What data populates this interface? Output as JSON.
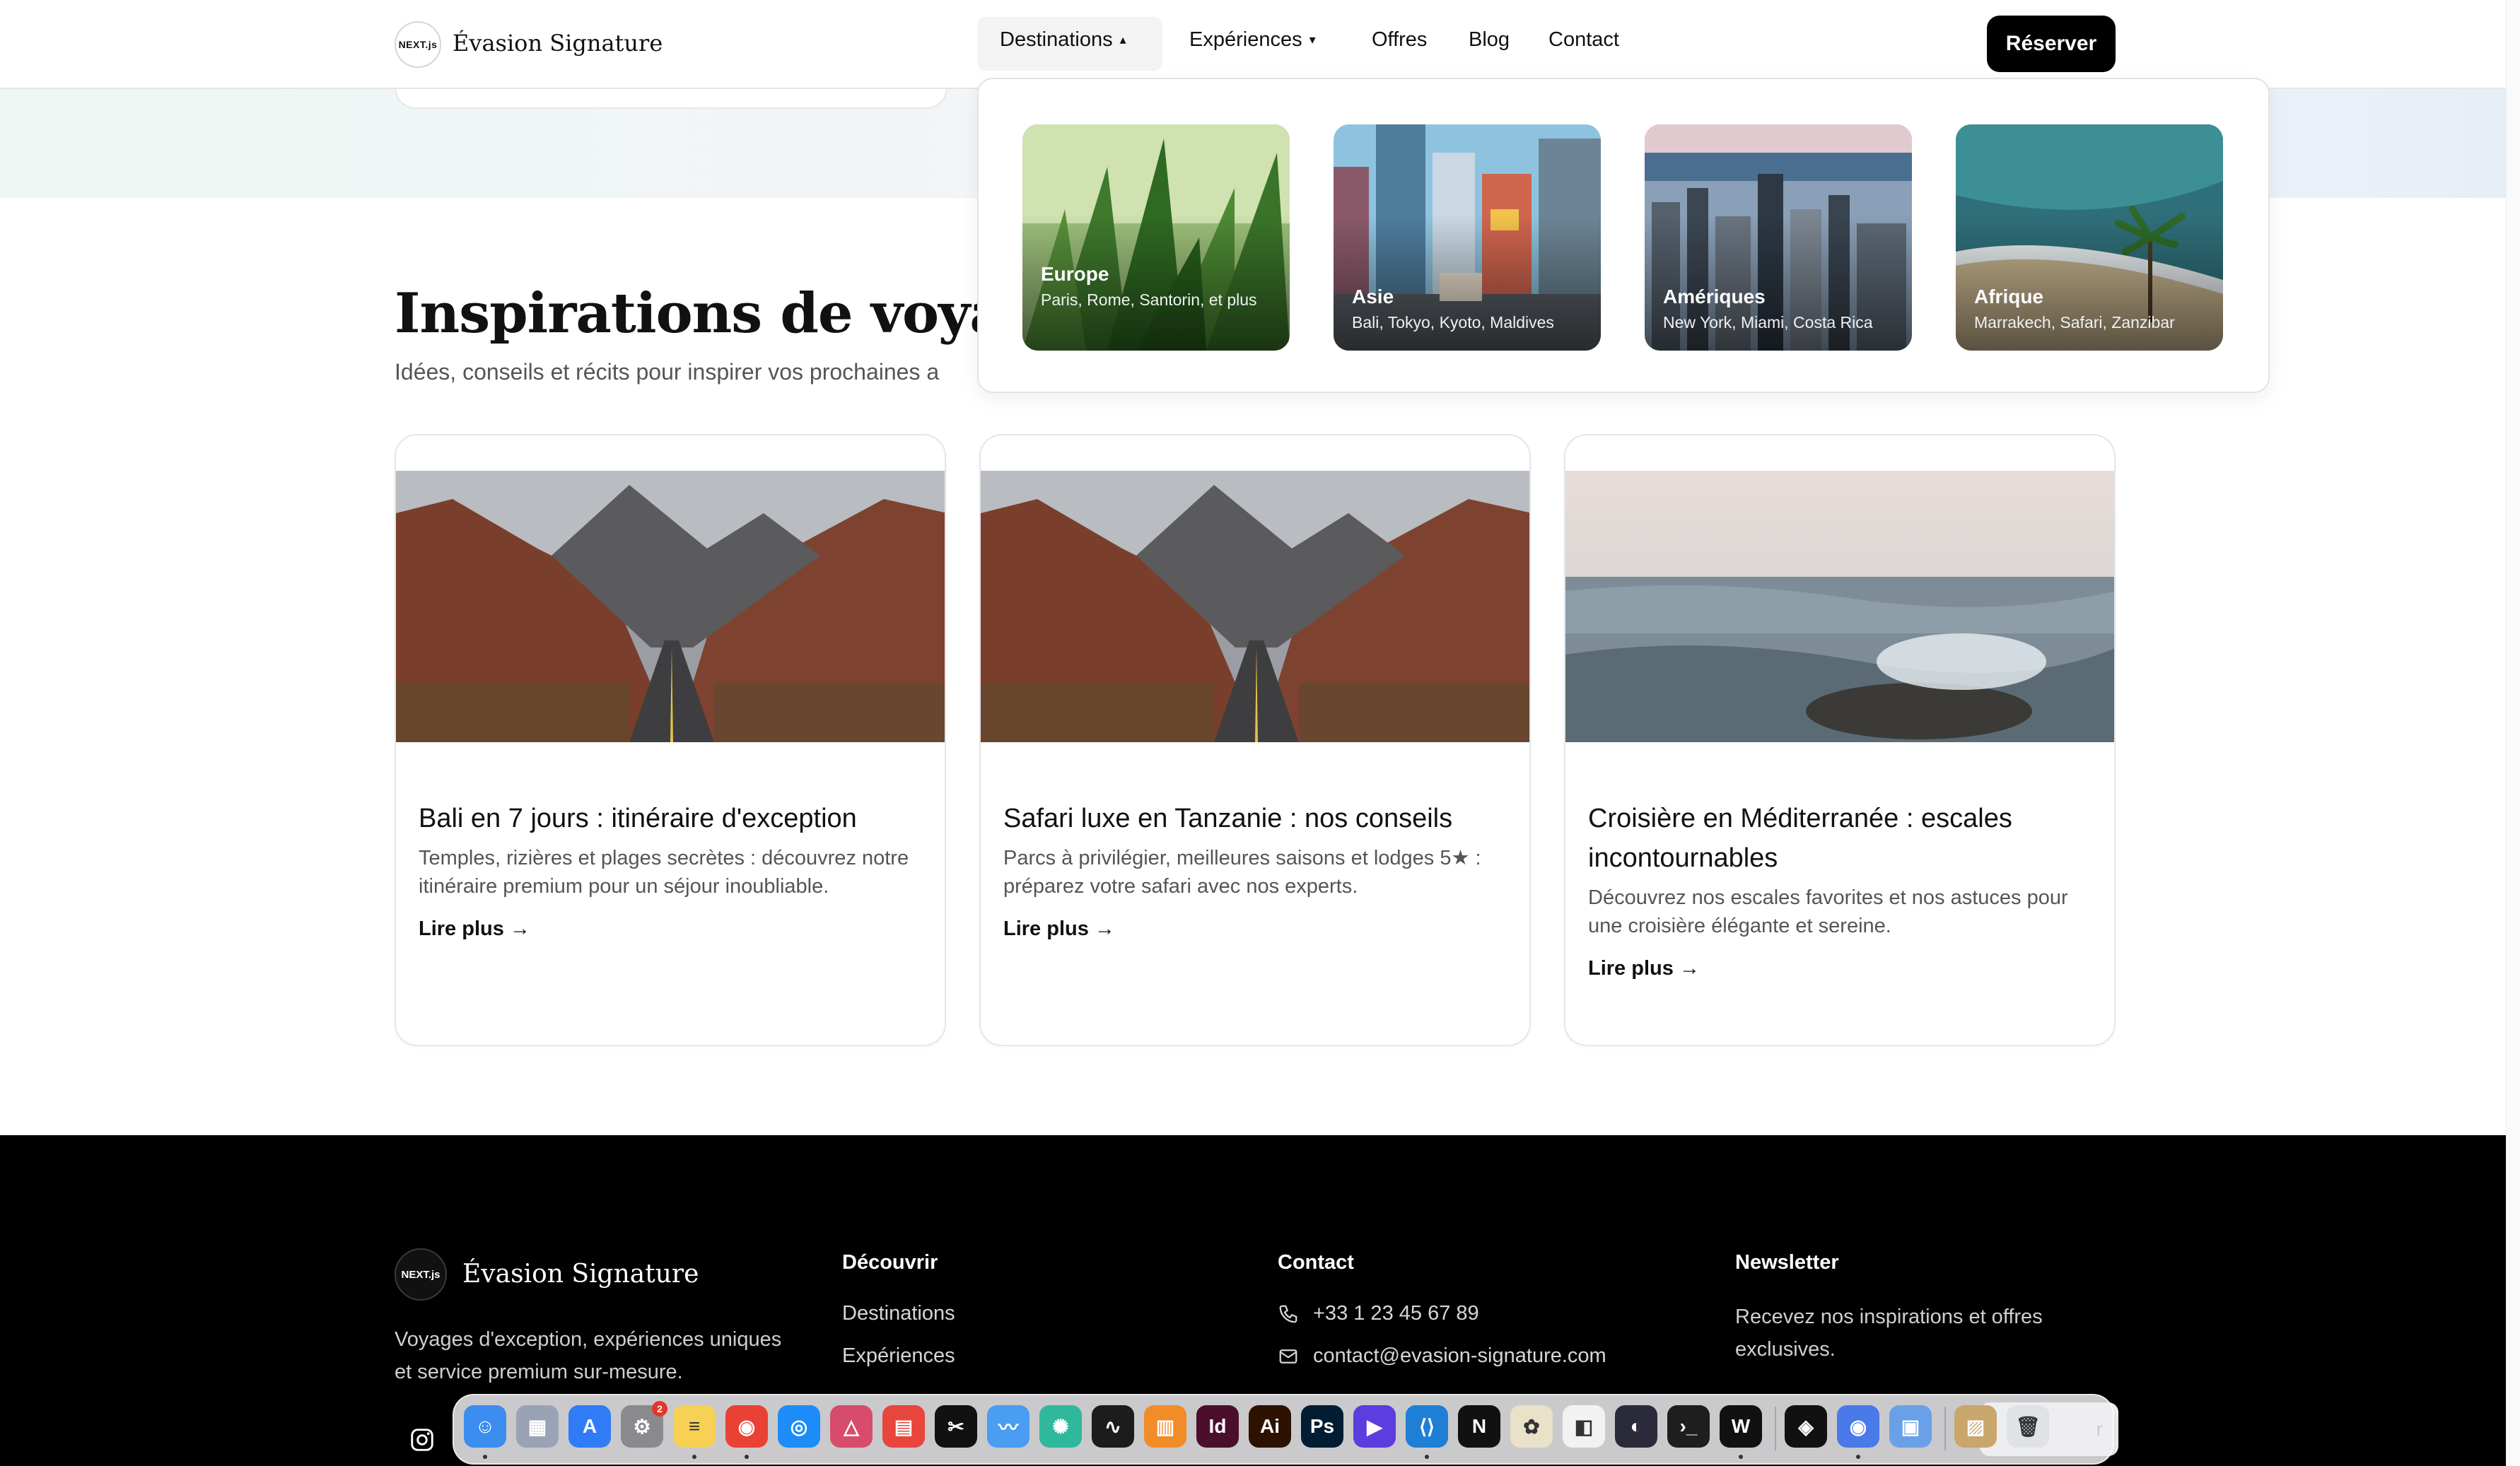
{
  "brand": {
    "logo_text": "NEXT.js",
    "name": "Évasion Signature"
  },
  "nav": {
    "items": [
      {
        "label": "Destinations",
        "chevron": "▴"
      },
      {
        "label": "Expériences",
        "chevron": "▾"
      },
      {
        "label": "Offres"
      },
      {
        "label": "Blog"
      },
      {
        "label": "Contact"
      }
    ],
    "cta": "Réserver"
  },
  "dropdown": {
    "destinations": [
      {
        "name": "Europe",
        "cities": "Paris, Rome, Santorin, et plus"
      },
      {
        "name": "Asie",
        "cities": "Bali, Tokyo, Kyoto, Maldives"
      },
      {
        "name": "Amériques",
        "cities": "New York, Miami, Costa Rica"
      },
      {
        "name": "Afrique",
        "cities": "Marrakech, Safari, Zanzibar"
      }
    ]
  },
  "section": {
    "title": "Inspirations de voyage",
    "subtitle": "Idées, conseils et récits pour inspirer vos prochaines a"
  },
  "articles": [
    {
      "title": "Bali en 7 jours : itinéraire d'exception",
      "description": "Temples, rizières et plages secrètes : découvrez notre itinéraire premium pour un séjour inoubliable.",
      "link": "Lire plus →"
    },
    {
      "title": "Safari luxe en Tanzanie : nos conseils",
      "description": "Parcs à privilégier, meilleures saisons et lodges 5★ : préparez votre safari avec nos experts.",
      "link": "Lire plus →"
    },
    {
      "title": "Croisière en Méditerranée : escales incontournables",
      "description": "Découvrez nos escales favorites et nos astuces pour une croisière élégante et sereine.",
      "link": "Lire plus →"
    }
  ],
  "footer": {
    "brand": "Évasion Signature",
    "logo_text": "NEXT.js",
    "tagline": "Voyages d'exception, expériences uniques et service premium sur-mesure.",
    "discover": {
      "heading": "Découvrir",
      "links": [
        "Destinations",
        "Expériences"
      ]
    },
    "contact": {
      "heading": "Contact",
      "phone": "+33 1 23 45 67 89",
      "email": "contact@evasion-signature.com"
    },
    "newsletter": {
      "heading": "Newsletter",
      "text": "Recevez nos inspirations et offres exclusives.",
      "button_tail": "r"
    }
  },
  "dock": {
    "apps": [
      {
        "name": "finder",
        "color": "#3b8df0",
        "glyph": "☺"
      },
      {
        "name": "launchpad",
        "color": "#9aa3b5",
        "glyph": "▦"
      },
      {
        "name": "app-store",
        "color": "#2f7cf6",
        "glyph": "A"
      },
      {
        "name": "system-settings",
        "color": "#8a8a8e",
        "glyph": "⚙",
        "badge": "2"
      },
      {
        "name": "notes",
        "color": "#f7d154",
        "glyph": "≡"
      },
      {
        "name": "chrome",
        "color": "#e94235",
        "glyph": "◉"
      },
      {
        "name": "safari",
        "color": "#1d8cf8",
        "glyph": "◎"
      },
      {
        "name": "affinity",
        "color": "#d74c6b",
        "glyph": "△"
      },
      {
        "name": "calendar-app",
        "color": "#e8453c",
        "glyph": "▤"
      },
      {
        "name": "capcut",
        "color": "#111111",
        "glyph": "✂"
      },
      {
        "name": "freeform",
        "color": "#4a9df0",
        "glyph": "〰"
      },
      {
        "name": "chatgpt",
        "color": "#2fb89b",
        "glyph": "✺"
      },
      {
        "name": "activity-monitor",
        "color": "#1c1c1c",
        "glyph": "∿"
      },
      {
        "name": "books",
        "color": "#f28c28",
        "glyph": "▥"
      },
      {
        "name": "indesign",
        "color": "#4b0f2c",
        "glyph": "Id"
      },
      {
        "name": "illustrator",
        "color": "#2d1200",
        "glyph": "Ai"
      },
      {
        "name": "photoshop",
        "color": "#001d34",
        "glyph": "Ps"
      },
      {
        "name": "screen-studio",
        "color": "#5b3de0",
        "glyph": "▶"
      },
      {
        "name": "vscode",
        "color": "#1f7fd4",
        "glyph": "⟨⟩"
      },
      {
        "name": "news",
        "color": "#111111",
        "glyph": "N"
      },
      {
        "name": "cider",
        "color": "#e9e1c8",
        "glyph": "✿"
      },
      {
        "name": "keynote",
        "color": "#f2f2f2",
        "glyph": "◧"
      },
      {
        "name": "loom",
        "color": "#2a2a3a",
        "glyph": "◐"
      },
      {
        "name": "terminal",
        "color": "#1e1e1e",
        "glyph": "›_"
      },
      {
        "name": "wordsmith",
        "color": "#111111",
        "glyph": "W"
      },
      {
        "name": "cube-app",
        "color": "#111111",
        "glyph": "◈"
      },
      {
        "name": "chrome-alt",
        "color": "#4a7ae8",
        "glyph": "◉"
      },
      {
        "name": "preview",
        "color": "#6aa0e8",
        "glyph": "▣"
      },
      {
        "name": "photos-folder",
        "color": "#c9a66b",
        "glyph": "▨"
      },
      {
        "name": "trash",
        "color": "#dfe2e6",
        "glyph": "🗑"
      }
    ]
  }
}
